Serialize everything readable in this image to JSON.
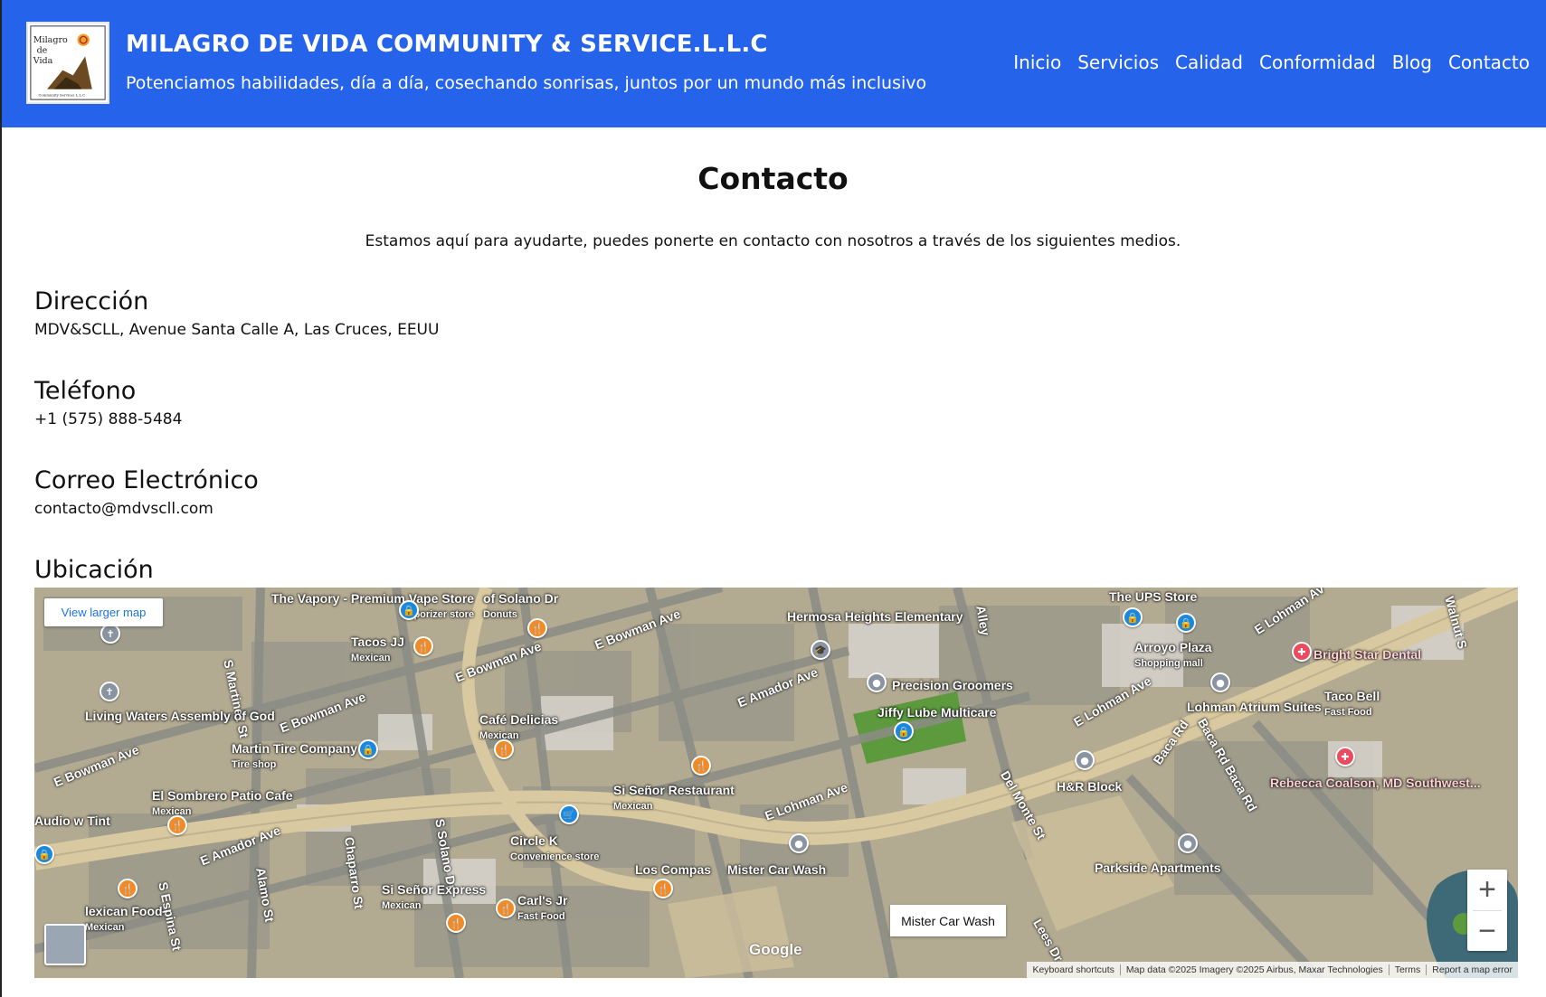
{
  "header": {
    "logo_alt": "Milagro de Vida Community Services LLC logo",
    "logo_text_1": "Milagro",
    "logo_text_2": "de",
    "logo_text_3": "Vida",
    "logo_text_4": "Community Services L.L.C",
    "title": "MILAGRO DE VIDA COMMUNITY & SERVICE.L.L.C",
    "tagline": "Potenciamos habilidades, día a día, cosechando sonrisas, juntos por un mundo más inclusivo",
    "nav": [
      "Inicio",
      "Servicios",
      "Calidad",
      "Conformidad",
      "Blog",
      "Contacto"
    ]
  },
  "main": {
    "title": "Contacto",
    "intro": "Estamos aquí para ayudarte, puedes ponerte en contacto con nosotros a través de los siguientes medios.",
    "address_heading": "Dirección",
    "address_value": "MDV&SCLL, Avenue Santa Calle A, Las Cruces, EEUU",
    "phone_heading": "Teléfono",
    "phone_value": "+1 (575) 888-5484",
    "email_heading": "Correo Electrónico",
    "email_value": "contacto@mdvscll.com",
    "location_heading": "Ubicación"
  },
  "map": {
    "view_larger": "View larger map",
    "zoom_in": "+",
    "zoom_out": "−",
    "place_card": "Mister Car Wash",
    "google": "Google",
    "attribution": [
      "Keyboard shortcuts",
      "Map data ©2025 Imagery ©2025 Airbus, Maxar Technologies",
      "Terms",
      "Report a map error"
    ],
    "places": {
      "vapory": "The Vapory - Premium Vape Store",
      "vapory_sub": "Vaporizer store",
      "tacos": "Tacos JJ",
      "tacos_sub": "Mexican",
      "donuts": "of Solano Dr",
      "donuts_sub": "Donuts",
      "hermosa": "Hermosa Heights Elementary",
      "ups": "The UPS Store",
      "arroyo": "Arroyo Plaza",
      "arroyo_sub": "Shopping mall",
      "brightstar": "Bright Star Dental",
      "living": "Living Waters Assembly of God",
      "cafe": "Café Delicias",
      "cafe_sub": "Mexican",
      "precision": "Precision Groomers",
      "jiffy": "Jiffy Lube Multicare",
      "lohman_atrium": "Lohman Atrium Suites",
      "taco_bell": "Taco Bell",
      "taco_bell_sub": "Fast Food",
      "martin": "Martin Tire Company",
      "martin_sub": "Tire shop",
      "sisenor_rest": "Si Señor Restaurant",
      "sisenor_rest_sub": "Mexican",
      "hr": "H&R Block",
      "rebecca": "Rebecca Coalson, MD Southwest...",
      "sombrero": "El Sombrero Patio Cafe",
      "sombrero_sub": "Mexican",
      "circlek": "Circle K",
      "circlek_sub": "Convenience store",
      "parkside": "Parkside Apartments",
      "audio": "Audio w Tint",
      "loscompas": "Los Compas",
      "mistercw": "Mister Car Wash",
      "sisenor_exp": "Si Señor Express",
      "sisenor_exp_sub": "Mexican",
      "carls": "Carl's Jr",
      "carls_sub": "Fast Food",
      "mexfood": "lexican Food",
      "mexfood_sub": "Mexican"
    },
    "streets": {
      "martinez": "S Martinez St",
      "bowman1": "E Bowman Ave",
      "bowman2": "E Bowman Ave",
      "bowman3": "E Bowman Ave",
      "bowman4": "E Bowman Ave",
      "amador1": "E Amador Ave",
      "amador2": "E Amador Ave",
      "lohman1": "E Lohman Ave",
      "lohman2": "E Lohman Ave",
      "lohman3": "E Lohman Av",
      "solano": "S Solano Dr",
      "chaparro": "Chaparro St",
      "alamo": "Alamo St",
      "espina": "S Espina St",
      "delmonte": "Del Monte St",
      "bacard": "Baca Rd",
      "bacard2": "Baca Rd Baca Rd",
      "lees": "Lees Dr",
      "alley": "Alley",
      "walnut": "Walnut S"
    }
  }
}
